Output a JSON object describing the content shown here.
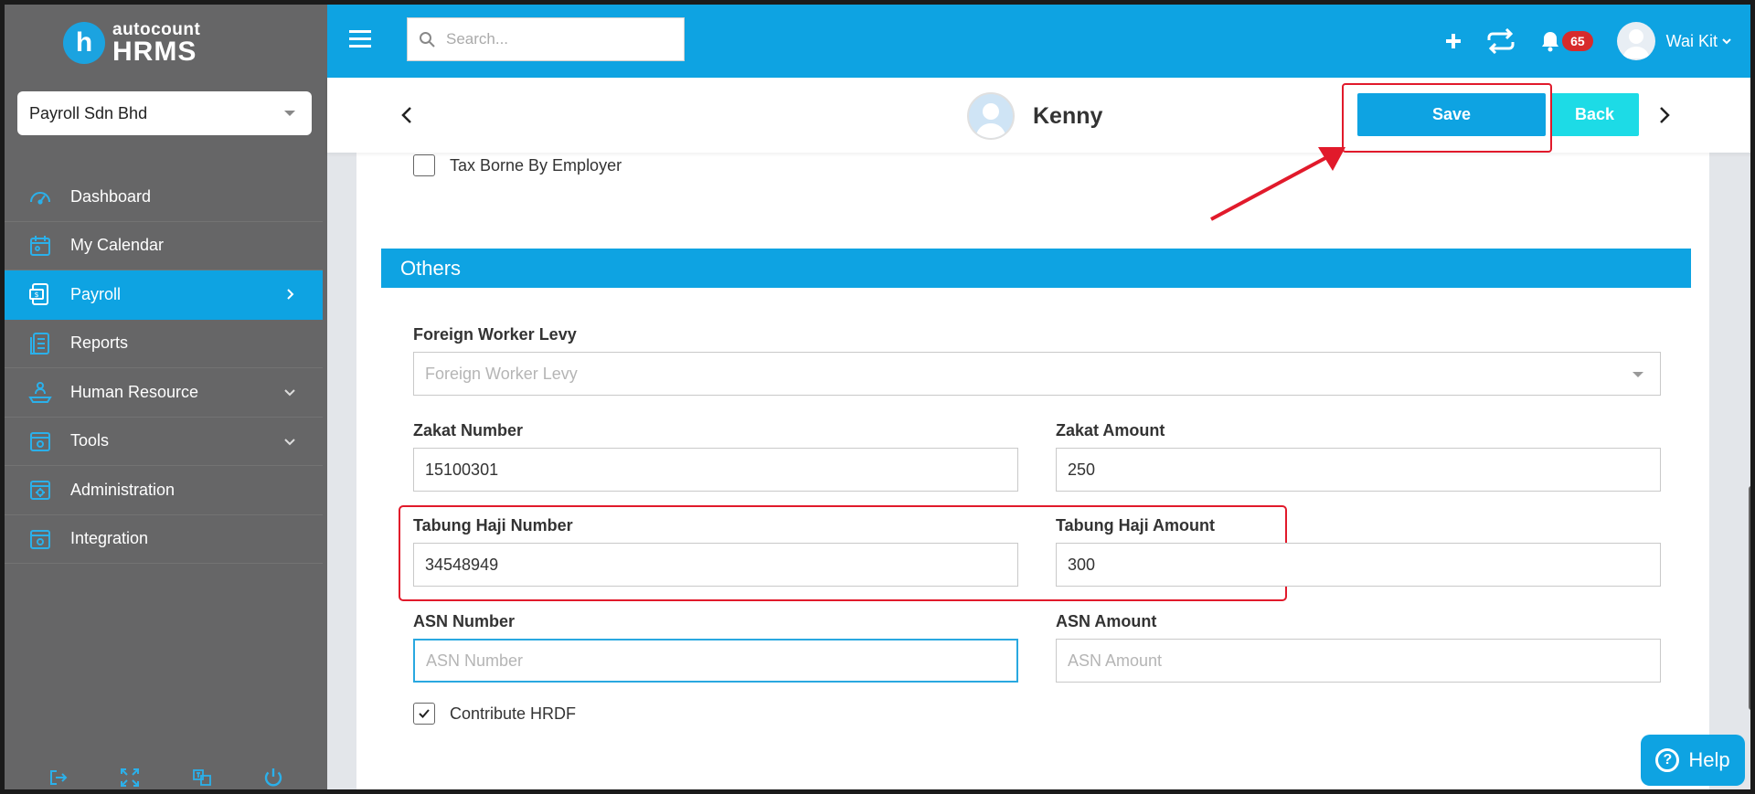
{
  "app": {
    "logo_top": "autocount",
    "logo_bottom": "HRMS",
    "logo_letter": "h"
  },
  "company_select": {
    "value": "Payroll Sdn Bhd"
  },
  "sidebar": {
    "items": [
      {
        "label": "Dashboard",
        "icon": "gauge-icon"
      },
      {
        "label": "My Calendar",
        "icon": "calendar-icon"
      },
      {
        "label": "Payroll",
        "icon": "money-icon",
        "active": true
      },
      {
        "label": "Reports",
        "icon": "report-icon"
      },
      {
        "label": "Human Resource",
        "icon": "people-icon"
      },
      {
        "label": "Tools",
        "icon": "tools-icon"
      },
      {
        "label": "Administration",
        "icon": "admin-icon"
      },
      {
        "label": "Integration",
        "icon": "integration-icon"
      }
    ]
  },
  "topbar": {
    "search_placeholder": "Search...",
    "notification_count": "65",
    "username": "Wai Kit"
  },
  "header": {
    "employee_name": "Kenny",
    "save_label": "Save",
    "back_label": "Back"
  },
  "form": {
    "tax_borne_label": "Tax Borne By Employer",
    "tax_borne_checked": false,
    "section_title": "Others",
    "foreign_worker_levy": {
      "label": "Foreign Worker Levy",
      "placeholder": "Foreign Worker Levy",
      "value": ""
    },
    "zakat_number": {
      "label": "Zakat Number",
      "value": "15100301"
    },
    "zakat_amount": {
      "label": "Zakat Amount",
      "value": "250"
    },
    "tabung_haji_number": {
      "label": "Tabung Haji Number",
      "value": "34548949"
    },
    "tabung_haji_amount": {
      "label": "Tabung Haji Amount",
      "value": "300"
    },
    "asn_number": {
      "label": "ASN Number",
      "placeholder": "ASN Number",
      "value": ""
    },
    "asn_amount": {
      "label": "ASN Amount",
      "placeholder": "ASN Amount",
      "value": ""
    },
    "contribute_hrdf_label": "Contribute HRDF",
    "contribute_hrdf_checked": true
  },
  "help": {
    "label": "Help"
  },
  "colors": {
    "primary": "#0ea3e2",
    "sidebar": "#666667",
    "highlight": "#e11a2b",
    "back": "#1ddbe6"
  }
}
